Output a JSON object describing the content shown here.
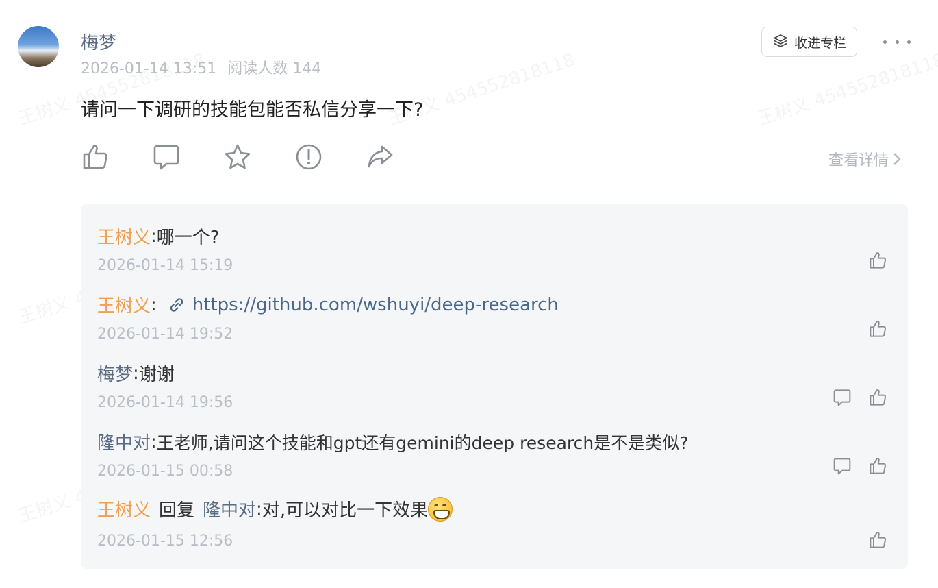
{
  "watermark": "王树义 454552818118",
  "post": {
    "author": "梅梦",
    "date": "2026-01-14 13:51",
    "reads": "阅读人数 144",
    "text": "请问一下调研的技能包能否私信分享一下?",
    "follow_label": "收进专栏",
    "view_detail_label": "查看详情"
  },
  "comments": [
    {
      "author": "王树义",
      "sep": ":",
      "text": "哪一个?",
      "time": "2026-01-14 15:19"
    },
    {
      "author": "王树义",
      "sep": ":",
      "link": "https://github.com/wshuyi/deep-research",
      "time": "2026-01-14 19:52"
    },
    {
      "author": "梅梦",
      "sep": ":",
      "text": "谢谢",
      "time": "2026-01-14 19:56"
    },
    {
      "author": "隆中对",
      "sep": ":",
      "text": "王老师,请问这个技能和gpt还有gemini的deep research是不是类似?",
      "time": "2026-01-15 00:58"
    },
    {
      "author": "王树义",
      "reply_word": "回复",
      "reply_to": "隆中对",
      "sep": ":",
      "text": "对,可以对比一下效果",
      "time": "2026-01-15 12:56"
    }
  ],
  "colors": {
    "orange_name": "#f0a050",
    "blue_name": "#5a6b85",
    "link": "#4a6788"
  }
}
